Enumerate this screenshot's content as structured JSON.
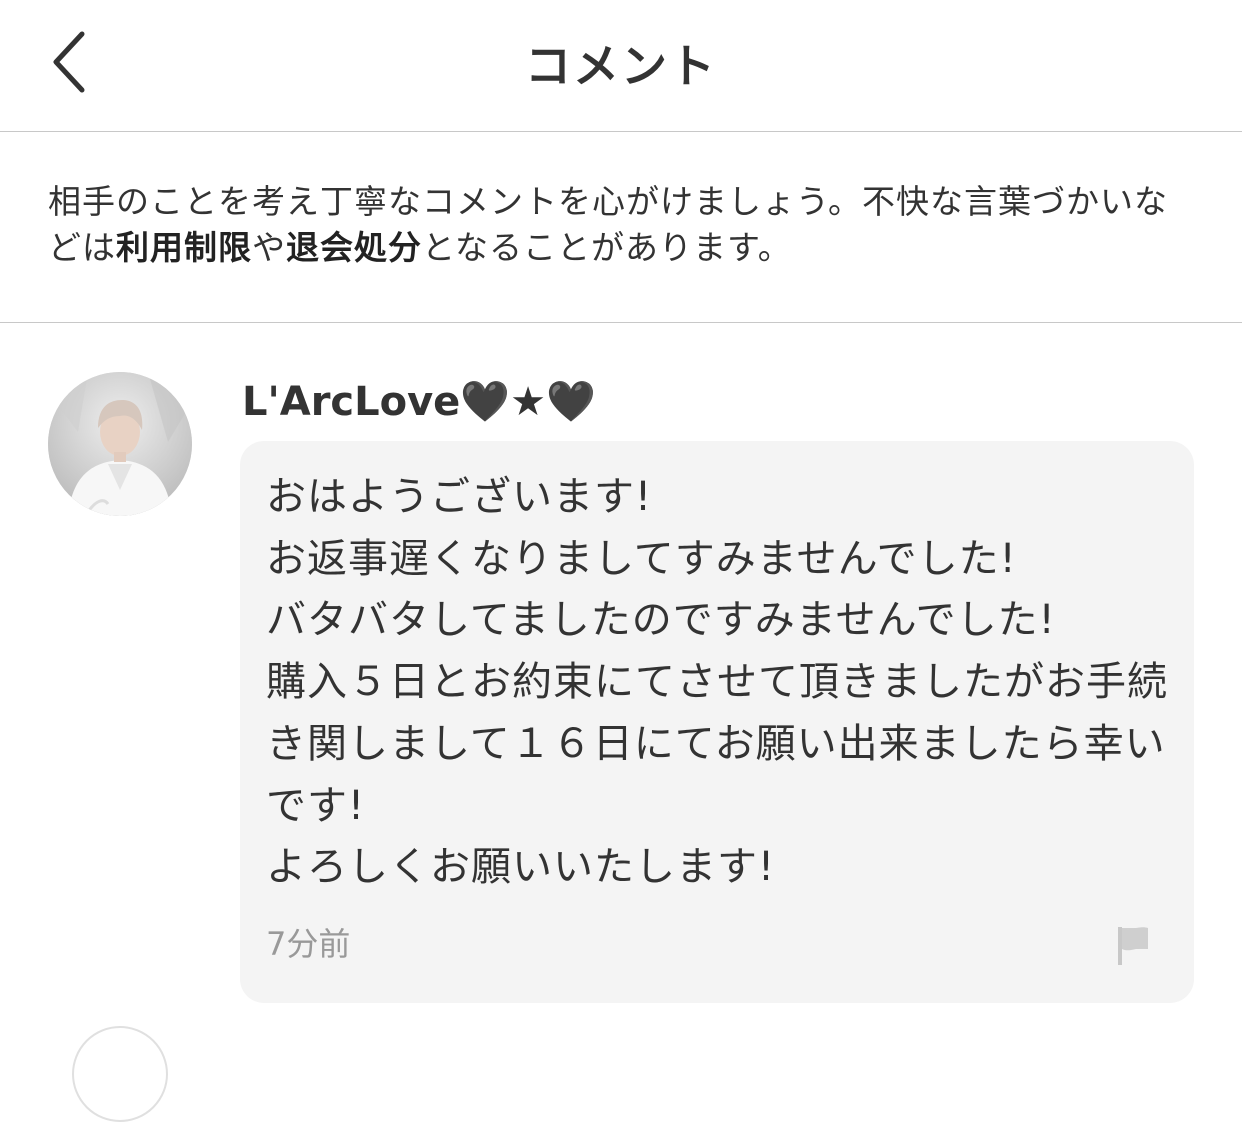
{
  "header": {
    "title": "コメント",
    "back_icon": "chevron-left-icon"
  },
  "notice": {
    "part1": "相手のことを考え丁寧なコメントを心がけましょう。不快な言葉づかいなどは",
    "bold1": "利用制限",
    "part2": "や",
    "bold2": "退会処分",
    "part3": "となることがあります。"
  },
  "comment": {
    "username": "L'ArcLove🖤★🖤",
    "message": "おはようございます!\nお返事遅くなりましてすみませんでした!\nバタバタしてましたのですみませんでした!\n購入５日とお約束にてさせて頂きましたがお手続き関しまして１６日にてお願い出来ましたら幸いです!\nよろしくお願いいたします!",
    "time": "7分前",
    "report_icon": "flag-icon"
  },
  "colors": {
    "text": "#333333",
    "divider": "#c8c8c8",
    "bubble": "#f4f4f4",
    "muted": "#999999"
  }
}
